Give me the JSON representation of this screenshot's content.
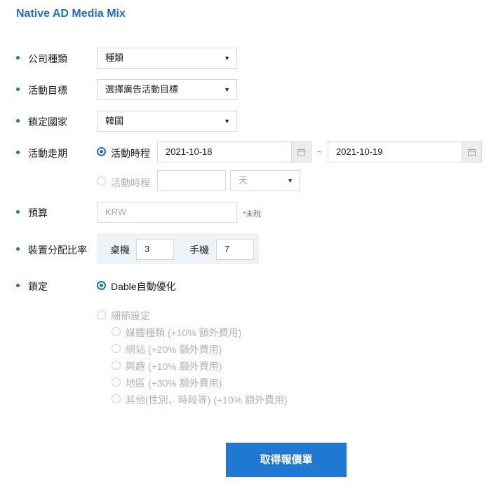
{
  "title": "Native AD Media Mix",
  "company_type": {
    "label": "公司種類",
    "value": "種類"
  },
  "campaign_goal": {
    "label": "活動目標",
    "value": "選擇廣告活動目標"
  },
  "target_country": {
    "label": "鎖定國家",
    "value": "韓國"
  },
  "campaign_period": {
    "label": "活動走期",
    "option_dates": {
      "label": "活動時程",
      "selected": true,
      "start": "2021-10-18",
      "end": "2021-10-19",
      "separator": "~"
    },
    "option_duration": {
      "label": "活動時程",
      "selected": false,
      "value": "",
      "unit": "天"
    }
  },
  "budget": {
    "label": "預算",
    "placeholder": "KRW",
    "note": "*未稅"
  },
  "device_ratio": {
    "label": "裝置分配比率",
    "desktop_label": "桌機",
    "desktop_value": "3",
    "mobile_label": "手機",
    "mobile_value": "7"
  },
  "targeting": {
    "label": "鎖定",
    "auto": {
      "label": "Dable自動優化",
      "selected": true
    },
    "detail": {
      "label": "細節設定",
      "selected": false,
      "options": [
        {
          "label": "媒體種類 (+10% 額外費用)"
        },
        {
          "label": "網站 (+20% 額外費用)"
        },
        {
          "label": "興趣 (+10% 額外費用)"
        },
        {
          "label": "地區 (+30% 額外費用)"
        },
        {
          "label": "其他(性別、時段等) (+10% 額外費用)"
        }
      ]
    }
  },
  "cta": {
    "label": "取得報價單"
  },
  "colors": {
    "accent": "#1f6fbe",
    "button": "#1f78d1",
    "disabled_text": "#b3b3b3"
  },
  "icons": {
    "select": "caret-down-icon",
    "calendar": "calendar-icon",
    "bullet": "bullet-icon"
  }
}
